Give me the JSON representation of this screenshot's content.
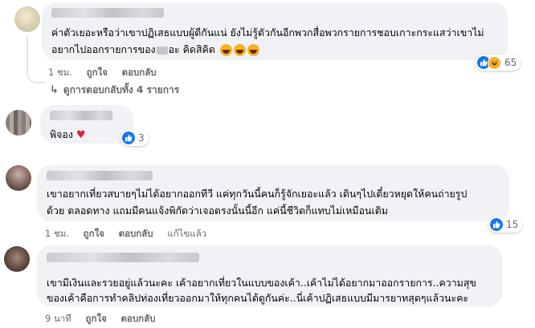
{
  "comments": [
    {
      "lines": [
        "ค่าตัวเยอะหรือว่าเขาปฏิเสธแบบผู้ดีกันแน่ ยังไม่รู้ตัวกันอีกพวกสื่อพวกรายการชอบเกาะกระแสว่าเขาไม่",
        "อยากไปออกรายการของ",
        "อะ คิดสิคิด"
      ],
      "emojis": [
        "laughing-emoji",
        "laughing-emoji",
        "laughing-emoji"
      ],
      "time": "1 ชม.",
      "like_label": "ถูกใจ",
      "reply_label": "ตอบกลับ",
      "reaction_count": "65",
      "view_replies": "ดูการตอบกลับทั้ง 4 รายการ"
    },
    {
      "lines": [
        "พิจอง"
      ],
      "reaction_count": "3"
    },
    {
      "lines": [
        "เขาอยากเที่ยวสบายๆไม่ได้อยากออกทีวี แค่ทุกวันนี้คนก็รู้จักเยอะแล้ว เดินๆไปเดี๋ยวหยุดให้คนถ่ายรูป",
        "ด้วย ตลอดทาง แถมมีคนแจ้งพิกัดว่าเจอตรงนั้นนี้อีก แค่นี้ชีวิตก็แทบไม่เหมือนเดิม"
      ],
      "time": "1 ชม.",
      "like_label": "ถูกใจ",
      "reply_label": "ตอบกลับ",
      "edited_label": "แก้ไขแล้ว",
      "reaction_count": "15"
    },
    {
      "lines": [
        "เขามีเงินและรวยอยู่แล้วนะคะ เค้าอยากเที่ยวในแบบของเค้า..เค้าไม่ได้อยากมาออกรายการ..ความสุข",
        "ของเค้าคือการทำคลิปท่องเที่ยวออกมาให้ทุกคนได้ดูกันค่ะ..นี่เค้าปฏิเสธแบบมีมารยาทสุดๆแล้วนะคะ"
      ],
      "time": "9 นาที",
      "like_label": "ถูกใจ",
      "reply_label": "ตอบกลับ"
    }
  ]
}
